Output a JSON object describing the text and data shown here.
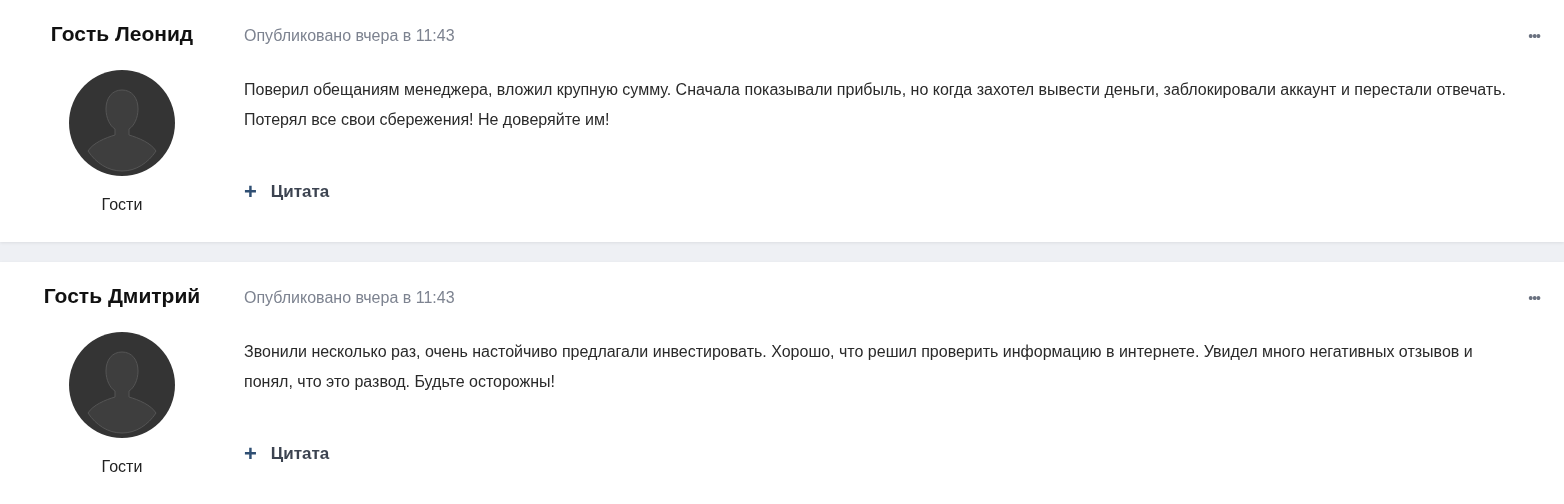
{
  "posts": [
    {
      "author": "Гость Леонид",
      "group": "Гости",
      "date": "Опубликовано вчера в 11:43",
      "text": "Поверил обещаниям менеджера, вложил крупную сумму. Сначала показывали прибыль, но когда захотел вывести деньги, заблокировали аккаунт и перестали отвечать. Потерял все свои сбережения! Не доверяйте им!",
      "quote_icon": "+",
      "quote_label": "Цитата",
      "menu": "•••"
    },
    {
      "author": "Гость Дмитрий",
      "group": "Гости",
      "date": "Опубликовано вчера в 11:43",
      "text": "Звонили несколько раз, очень настойчиво предлагали инвестировать. Хорошо, что решил проверить информацию в интернете. Увидел много негативных отзывов и понял, что это развод. Будьте осторожны!",
      "quote_icon": "+",
      "quote_label": "Цитата",
      "menu": "•••"
    }
  ]
}
